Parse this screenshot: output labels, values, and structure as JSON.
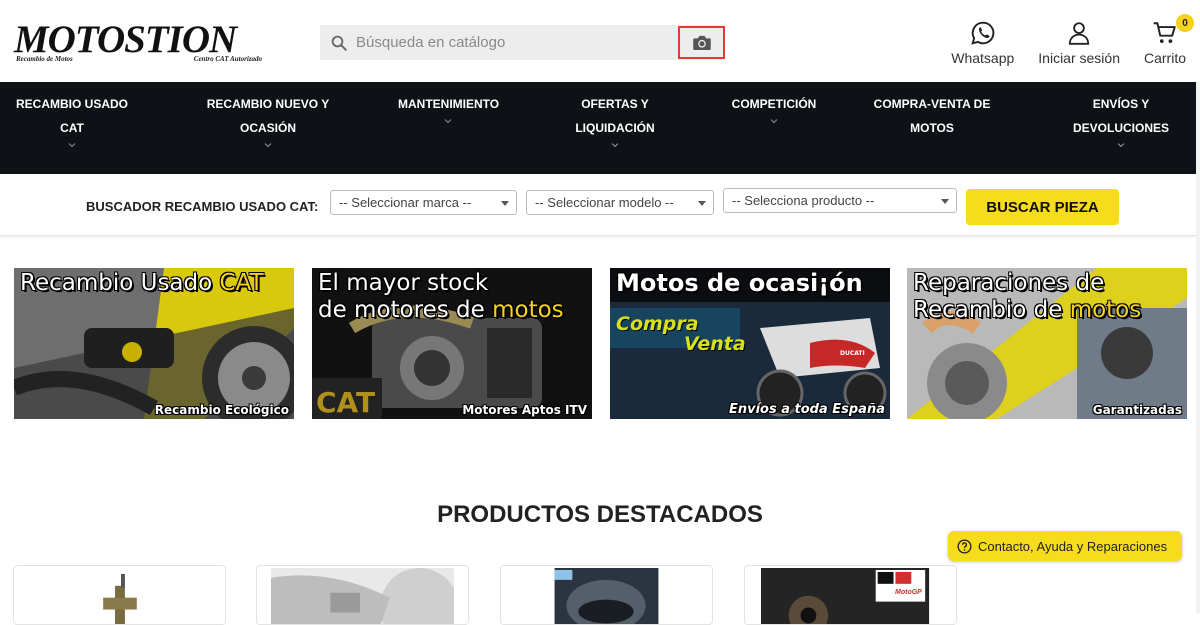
{
  "logo": {
    "name": "MOTOSTION",
    "tagline_left": "Recambio de Motos",
    "tagline_right": "Centro CAT Autorizado"
  },
  "search": {
    "placeholder": "Búsqueda en catálogo"
  },
  "header_actions": {
    "whatsapp": "Whatsapp",
    "login": "Iniciar sesión",
    "cart": "Carrito",
    "cart_count": "0"
  },
  "nav": {
    "items": [
      {
        "label": "RECAMBIO USADO CAT"
      },
      {
        "label": "RECAMBIO NUEVO Y OCASIÓN"
      },
      {
        "label": "MANTENIMIENTO"
      },
      {
        "label": "OFERTAS Y LIQUIDACIÓN"
      },
      {
        "label": "COMPETICIÓN"
      },
      {
        "label": "COMPRA-VENTA DE MOTOS"
      },
      {
        "label": "ENVÍOS Y DEVOLUCIONES"
      }
    ]
  },
  "finder": {
    "label": "BUSCADOR RECAMBIO USADO CAT:",
    "brand_select": "-- Seleccionar marca --",
    "model_select": "-- Seleccionar modelo --",
    "product_select": "-- Selecciona producto --",
    "button": "BUSCAR PIEZA"
  },
  "banners": [
    {
      "line1": "Recambio Usado",
      "highlight": "CAT",
      "line2": "",
      "footer": "Recambio Ecológico"
    },
    {
      "line1": "El mayor stock",
      "line2": "de motores de",
      "highlight": "motos",
      "footer": "Motores Aptos ITV",
      "watermark": "CAT"
    },
    {
      "line1": "Motos de ocasi¡ón",
      "sub1": "Compra",
      "sub2": "Venta",
      "footer": "Envíos a toda España",
      "brand": "DUCATI"
    },
    {
      "line1": "Reparaciones de",
      "line2": "Recambio de",
      "highlight": "motos",
      "footer": "Garantizadas"
    }
  ],
  "featured": {
    "title": "PRODUCTOS DESTACADOS",
    "motogp_logo": "MotoGP"
  },
  "contact": {
    "label": "Contacto, Ayuda y Reparaciones"
  },
  "colors": {
    "nav_bg": "#0e1116",
    "accent_yellow": "#f7dc1b",
    "camera_border": "#e53935"
  }
}
